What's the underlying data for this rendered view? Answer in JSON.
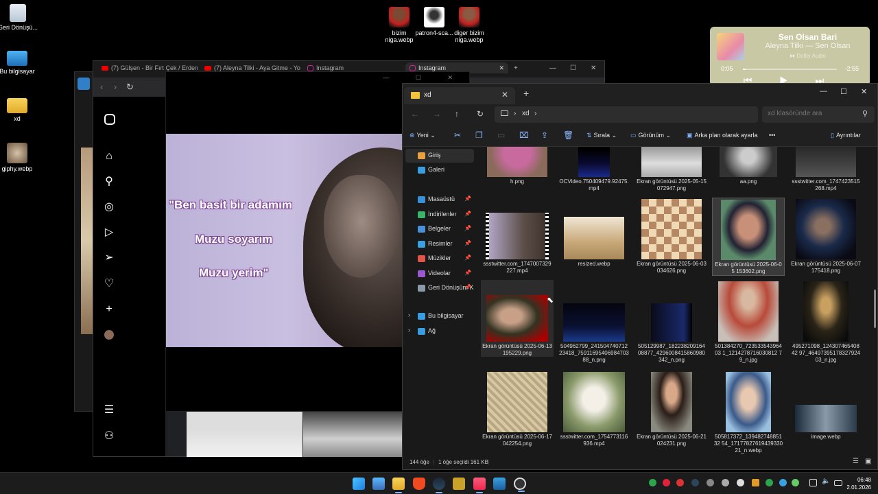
{
  "desktop": {
    "icons": [
      {
        "label": "Geri Dönüşü...",
        "icon": "recycle-bin-icon"
      },
      {
        "label": "Bu bilgisayar",
        "icon": "computer-icon"
      },
      {
        "label": "xd",
        "icon": "folder-icon"
      },
      {
        "label": "giphy.webp",
        "icon": "image-file-icon"
      },
      {
        "label": "bizim niga.webp",
        "icon": "image-file-icon"
      },
      {
        "label": "patron4-sca...",
        "icon": "image-file-icon"
      },
      {
        "label": "diger bizim niga.webp",
        "icon": "image-file-icon"
      }
    ]
  },
  "music_widget": {
    "title": "Sen Olsan Bari",
    "artist": "Aleyna Tilki — Sen Olsan",
    "badge": "Dolby Audio",
    "elapsed": "0:05",
    "remaining": "-2:55",
    "progress": 0.03,
    "controls": "⏮ ▶ ⏭"
  },
  "browser": {
    "tabs": [
      {
        "label": "(7) Gülşen - Bir Fırt Çek / Erdem...",
        "icon": "youtube-icon"
      },
      {
        "label": "(7) Aleyna Tilki - Aya Gitme - Yo...",
        "icon": "youtube-icon"
      },
      {
        "label": "Instagram",
        "icon": "instagram-icon"
      },
      {
        "label": "Instagram",
        "icon": "instagram-icon"
      }
    ],
    "window_controls": {
      "new_tab": "+",
      "minimize": "—",
      "maximize": "☐",
      "close": "✕"
    },
    "nav": {
      "back": "‹",
      "forward": "›",
      "reload": "↻"
    },
    "instagram_sidebar": [
      "instagram-icon",
      "home-icon",
      "search-icon",
      "explore-icon",
      "reels-icon",
      "messages-icon",
      "notifications-icon",
      "create-icon",
      "profile-avatar",
      "menu-icon",
      "threads-icon"
    ]
  },
  "video_overlay": {
    "captions": [
      "\"Ben basit bir adamım",
      "Muzu soyarım",
      "Muzu yerim\""
    ],
    "controls": "— ☐ ✕"
  },
  "explorer": {
    "tab_title": "xd",
    "tab_close": "✕",
    "new_tab": "+",
    "window_controls": {
      "minimize": "—",
      "maximize": "☐",
      "close": "✕"
    },
    "breadcrumb": [
      "xd"
    ],
    "search_placeholder": "xd klasöründe ara",
    "commands": {
      "new": "Yeni",
      "sort": "Sırala",
      "view": "Görünüm",
      "set_background": "Arka plan olarak ayarla",
      "more": "•••",
      "details": "Ayrıntılar"
    },
    "nav": {
      "top": [
        {
          "label": "Giriş",
          "selected": true,
          "color": "#e8a040"
        },
        {
          "label": "Galeri",
          "selected": false,
          "color": "#3a9de0"
        }
      ],
      "pinned": [
        {
          "label": "Masaüstü",
          "color": "#3a8fd6"
        },
        {
          "label": "İndirilenler",
          "color": "#3bb36a"
        },
        {
          "label": "Belgeler",
          "color": "#4a90d9"
        },
        {
          "label": "Resimler",
          "color": "#3aa0e0"
        },
        {
          "label": "Müzikler",
          "color": "#e0554a"
        },
        {
          "label": "Videolar",
          "color": "#9b59d0"
        },
        {
          "label": "Geri Dönüşüm K",
          "color": "#8a9aa8"
        }
      ],
      "bottom": [
        {
          "label": "Bu bilgisayar",
          "color": "#3a9de0"
        },
        {
          "label": "Ağ",
          "color": "#3a9de0"
        }
      ]
    },
    "files": [
      {
        "name": "h.png",
        "thumb": "heart"
      },
      {
        "name": "OCVideo.750409479.92475.mp4",
        "thumb": "dark-chart"
      },
      {
        "name": "Ekran görüntüsü 2025-05-15 072947.png",
        "thumb": "bw-photo"
      },
      {
        "name": "aa.png",
        "thumb": "bw-portrait"
      },
      {
        "name": "ssstwitter.com_1747423515268.mp4",
        "thumb": "dark-photo"
      },
      {
        "name": "ssstwitter.com_1747007329227.mp4",
        "thumb": "monkey-film"
      },
      {
        "name": "resized.webp",
        "thumb": "desert"
      },
      {
        "name": "Ekran görüntüsü 2025-06-03 034626.png",
        "thumb": "chess"
      },
      {
        "name": "Ekran görüntüsü 2025-06-05 153602.png",
        "thumb": "portrait-green"
      },
      {
        "name": "Ekran görüntüsü 2025-06-07 175418.png",
        "thumb": "blue-portrait"
      },
      {
        "name": "Ekran görüntüsü 2025-06-13 195229.png",
        "thumb": "man-crying"
      },
      {
        "name": "504962799_24150474071223418_7591169540698470388_n.png",
        "thumb": "dark-screen"
      },
      {
        "name": "505129987_18223820916408877_4296008415860980342_n.png",
        "thumb": "dark-screen2"
      },
      {
        "name": "501384270_72353354396403 1_1214278716030812 79_n.jpg",
        "thumb": "red-shirt"
      },
      {
        "name": "495271098_12430746540842 97_4649739517832792403_n.jpg",
        "thumb": "dark-man"
      },
      {
        "name": "Ekran görüntüsü 2025-06-17 042254.png",
        "thumb": "carpet"
      },
      {
        "name": "ssstwitter.com_1754773116936.mp4",
        "thumb": "cat"
      },
      {
        "name": "Ekran görüntüsü 2025-06-21 024231.png",
        "thumb": "curly"
      },
      {
        "name": "505817372_13948274885132 54_1717782761943933021_n.webp",
        "thumb": "sunglasses"
      },
      {
        "name": "image.webp",
        "thumb": "wide-dark"
      }
    ],
    "status": {
      "count": "144 öğe",
      "selected": "1 öğe seçildi  161 KB"
    }
  },
  "taskbar": {
    "apps": [
      "windows-start-icon",
      "file-explorer-photo-icon",
      "file-explorer-icon",
      "brave-icon",
      "steam-icon",
      "game-icon",
      "apple-music-icon",
      "snipping-tool-icon",
      "media-player-icon"
    ],
    "clock_time": "06:48",
    "clock_date": "2.01.2026"
  }
}
